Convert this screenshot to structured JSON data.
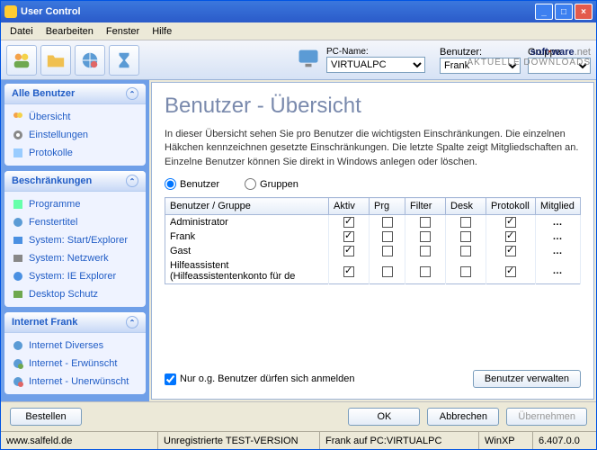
{
  "window": {
    "title": "User Control"
  },
  "menu": {
    "items": [
      "Datei",
      "Bearbeiten",
      "Fenster",
      "Hilfe"
    ]
  },
  "toolbar": {
    "pc_label": "PC-Name:",
    "pc_value": "VIRTUALPC",
    "user_label": "Benutzer:",
    "user_value": "Frank",
    "group_label": "Gruppe"
  },
  "logo": {
    "part1": "soft",
    "dash": "·",
    "part2": "ware",
    "net": ".net",
    "tag": "AKTUELLE DOWNLOADS"
  },
  "sidebar": {
    "s1": {
      "title": "Alle Benutzer",
      "items": [
        "Übersicht",
        "Einstellungen",
        "Protokolle"
      ]
    },
    "s2": {
      "title": "Beschränkungen",
      "items": [
        "Programme",
        "Fenstertitel",
        "System: Start/Explorer",
        "System: Netzwerk",
        "System: IE Explorer",
        "Desktop Schutz"
      ]
    },
    "s3": {
      "title": "Internet Frank",
      "items": [
        "Internet Diverses",
        "Internet - Erwünscht",
        "Internet - Unerwünscht"
      ]
    }
  },
  "main": {
    "heading": "Benutzer - Übersicht",
    "desc": "In dieser Übersicht sehen Sie pro Benutzer die wichtigsten Einschränkungen. Die einzelnen Häkchen kennzeichnen gesetzte Einschränkungen. Die letzte Spalte zeigt Mitgliedschaften an. Einzelne Benutzer können Sie direkt in Windows anlegen oder löschen.",
    "radio_user": "Benutzer",
    "radio_group": "Gruppen",
    "cols": {
      "c0": "Benutzer / Gruppe",
      "c1": "Aktiv",
      "c2": "Prg",
      "c3": "Filter",
      "c4": "Desk",
      "c5": "Protokoll",
      "c6": "Mitglied"
    },
    "rows": [
      {
        "name": "Administrator",
        "aktiv": true,
        "prg": false,
        "filter": false,
        "desk": false,
        "protokoll": true
      },
      {
        "name": "Frank",
        "aktiv": true,
        "prg": false,
        "filter": false,
        "desk": false,
        "protokoll": true
      },
      {
        "name": "Gast",
        "aktiv": true,
        "prg": false,
        "filter": false,
        "desk": false,
        "protokoll": true
      },
      {
        "name": "Hilfeassistent (Hilfeassistentenkonto für de",
        "aktiv": true,
        "prg": false,
        "filter": false,
        "desk": false,
        "protokoll": true
      }
    ],
    "only_label": "Nur o.g. Benutzer dürfen sich anmelden",
    "manage_btn": "Benutzer verwalten"
  },
  "footer": {
    "order": "Bestellen",
    "ok": "OK",
    "cancel": "Abbrechen",
    "apply": "Übernehmen"
  },
  "status": {
    "s0": "www.salfeld.de",
    "s1": "Unregistrierte TEST-VERSION",
    "s2": "Frank auf PC:VIRTUALPC",
    "s3": "WinXP",
    "s4": "6.407.0.0"
  }
}
